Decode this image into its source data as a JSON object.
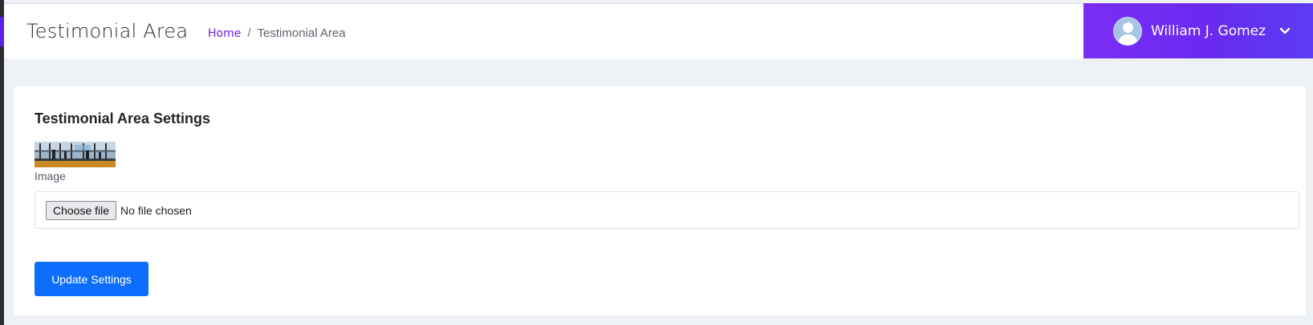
{
  "header": {
    "page_title": "Testimonial Area",
    "breadcrumb": {
      "home": "Home",
      "separator": "/",
      "current": "Testimonial Area"
    },
    "user": {
      "name": "William J. Gomez",
      "avatar_icon": "user-avatar-icon",
      "dropdown_icon": "chevron-down-icon"
    }
  },
  "settings_card": {
    "title": "Testimonial Area Settings",
    "image_label": "Image",
    "file_input": {
      "button_label": "Choose file",
      "status": "No file chosen"
    },
    "submit_label": "Update Settings"
  },
  "colors": {
    "accent_purple": "#6a22e0",
    "user_box_gradient_start": "#7a2cf3",
    "user_box_gradient_end": "#5a3cf2",
    "primary_button": "#0d6efd",
    "page_background": "#eef2f6"
  }
}
